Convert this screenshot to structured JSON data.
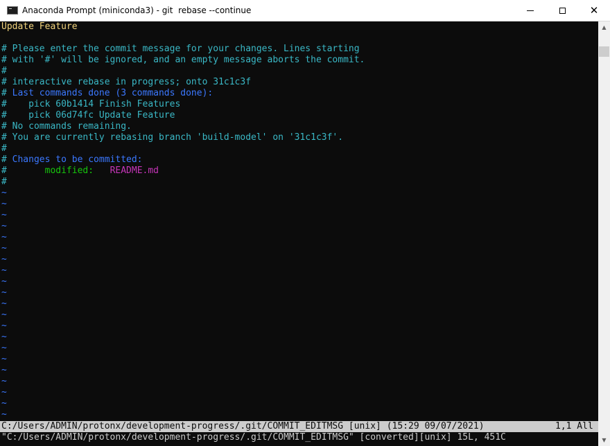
{
  "window": {
    "title": "Anaconda Prompt (miniconda3) - git  rebase --continue",
    "icon": "terminal-icon",
    "controls": {
      "minimize": "minimize-icon",
      "maximize": "maximize-icon",
      "close": "close-icon"
    }
  },
  "editor": {
    "line1": "Update Feature",
    "line2": "",
    "line3": "# Please enter the commit message for your changes. Lines starting",
    "line4": "# with '#' will be ignored, and an empty message aborts the commit.",
    "line5": "#",
    "line6": "# interactive rebase in progress; onto 31c1c3f",
    "line7_hash": "#",
    "line7_text": " Last commands done (3 commands done):",
    "line8_hash": "#",
    "line8_text": "    pick 60b1414 Finish Features",
    "line9_hash": "#",
    "line9_text": "    pick 06d74fc Update Feature",
    "line10_hash": "#",
    "line10_text": " No commands remaining.",
    "line11_hash": "#",
    "line11_text": " You are currently rebasing branch 'build-model' on '31c1c3f'.",
    "line12": "#",
    "line13_hash": "#",
    "line13_text": " Changes to be committed:",
    "line14_hash": "#",
    "line14_label": "modified:",
    "line14_file": "README.md",
    "line15": "#",
    "tilde": "~"
  },
  "status": {
    "path": "C:/Users/ADMIN/protonx/development-progress/.git/COMMIT_EDITMSG [unix] (15:29 09/07/2021)",
    "position": "1,1 All"
  },
  "message": "\"C:/Users/ADMIN/protonx/development-progress/.git/COMMIT_EDITMSG\" [converted][unix] 15L, 451C",
  "colors": {
    "background": "#0c0c0c",
    "text": "#cccccc",
    "yellow": "#f2d47d",
    "cyan": "#3ab8c6",
    "blue": "#3b78ff",
    "green": "#16c60c",
    "magenta": "#c535b8"
  }
}
